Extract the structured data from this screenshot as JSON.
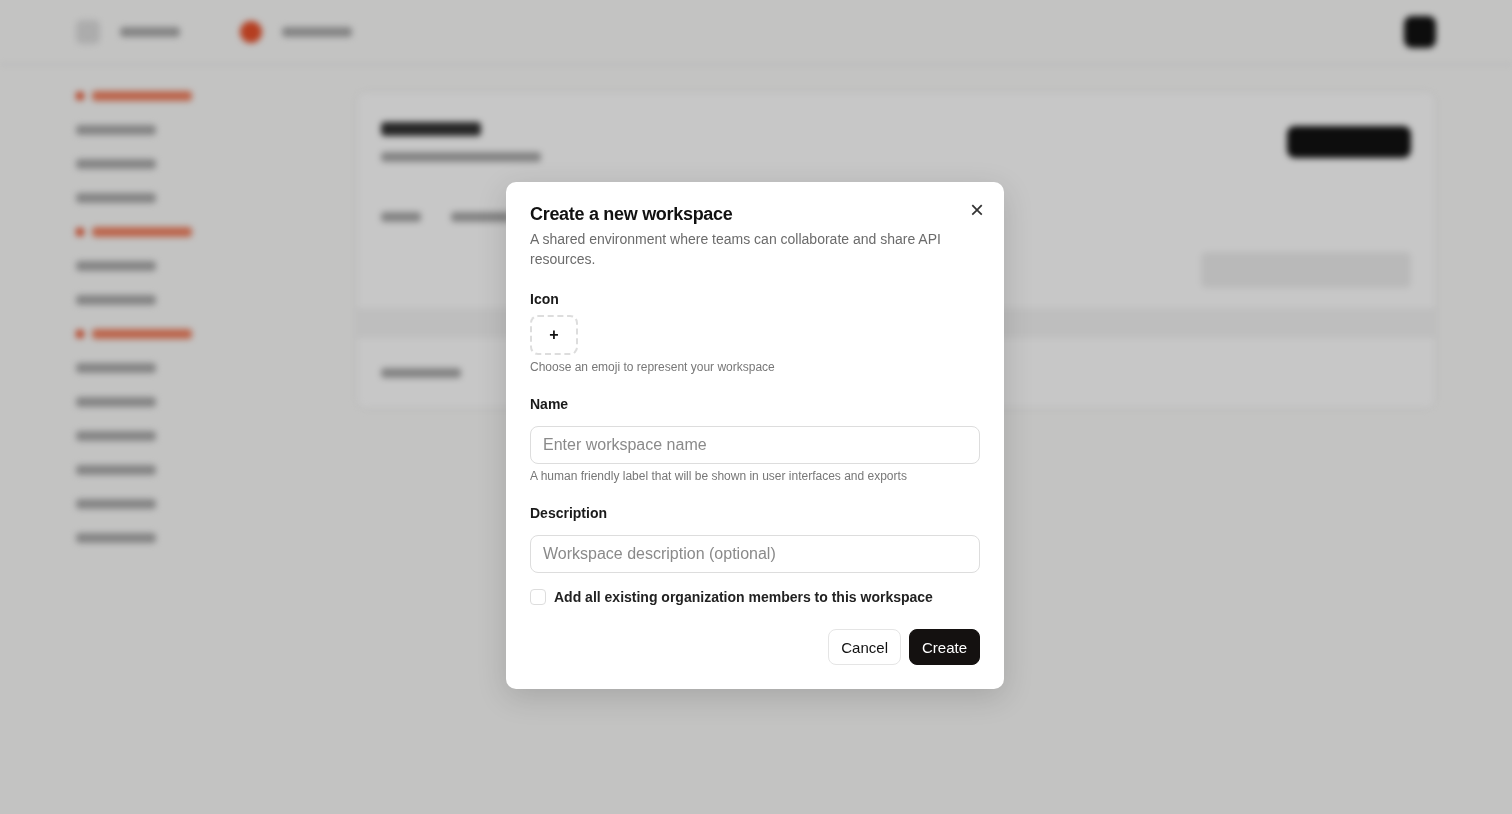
{
  "dialog": {
    "title": "Create a new workspace",
    "description": "A shared environment where teams can collaborate and share API resources.",
    "close_glyph": "×",
    "icon_field": {
      "label": "Icon",
      "button_glyph": "+",
      "hint": "Choose an emoji to represent your workspace"
    },
    "name_field": {
      "label": "Name",
      "placeholder": "Enter workspace name",
      "hint": "A human friendly label that will be shown in user interfaces and exports"
    },
    "description_field": {
      "label": "Description",
      "placeholder": "Workspace description (optional)"
    },
    "add_members": {
      "label": "Add all existing organization members to this workspace",
      "checked": false
    },
    "buttons": [
      {
        "label": "Cancel",
        "kind": "secondary"
      },
      {
        "label": "Create",
        "kind": "primary"
      }
    ]
  }
}
